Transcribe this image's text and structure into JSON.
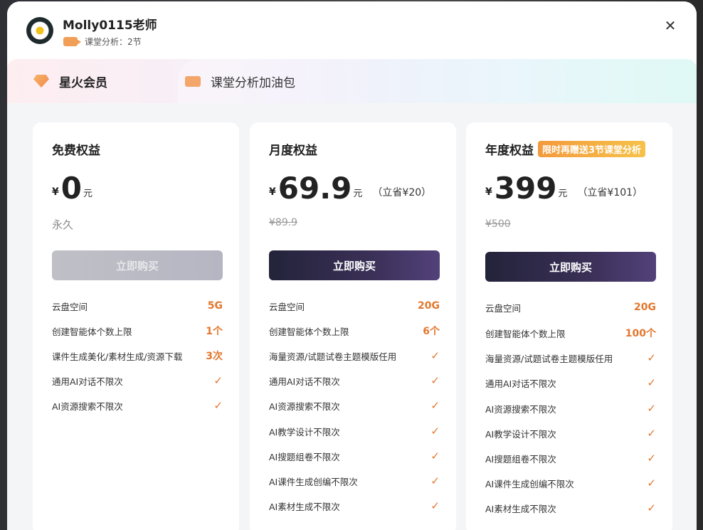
{
  "user": {
    "name": "Molly0115老师",
    "sub_label": "课堂分析：2节"
  },
  "tabs": [
    {
      "label": "星火会员"
    },
    {
      "label": "课堂分析加油包"
    }
  ],
  "plans": [
    {
      "title": "免费权益",
      "currency": "¥",
      "price": "0",
      "unit": "元",
      "note": "永久",
      "button": "立即购买",
      "features": [
        {
          "label": "云盘空间",
          "value": "5G"
        },
        {
          "label": "创建智能体个数上限",
          "value": "1个"
        },
        {
          "label": "课件生成美化/素材生成/资源下载",
          "value": "3次"
        },
        {
          "label": "通用AI对话不限次",
          "value": "✓"
        },
        {
          "label": "AI资源搜索不限次",
          "value": "✓"
        }
      ]
    },
    {
      "title": "月度权益",
      "currency": "¥",
      "price": "69.9",
      "unit": "元",
      "save": "（立省¥20）",
      "original": "¥89.9",
      "button": "立即购买",
      "features": [
        {
          "label": "云盘空间",
          "value": "20G"
        },
        {
          "label": "创建智能体个数上限",
          "value": "6个"
        },
        {
          "label": "海量资源/试题试卷主题模版任用",
          "value": "✓"
        },
        {
          "label": "通用AI对话不限次",
          "value": "✓"
        },
        {
          "label": "AI资源搜索不限次",
          "value": "✓"
        },
        {
          "label": "AI教学设计不限次",
          "value": "✓"
        },
        {
          "label": "AI搜题组卷不限次",
          "value": "✓"
        },
        {
          "label": "AI课件生成创编不限次",
          "value": "✓"
        },
        {
          "label": "AI素材生成不限次",
          "value": "✓"
        }
      ]
    },
    {
      "title": "年度权益",
      "promo": "限时再赠送3节课堂分析",
      "currency": "¥",
      "price": "399",
      "unit": "元",
      "save": "（立省¥101）",
      "original": "¥500",
      "button": "立即购买",
      "features": [
        {
          "label": "云盘空间",
          "value": "20G"
        },
        {
          "label": "创建智能体个数上限",
          "value": "100个"
        },
        {
          "label": "海量资源/试题试卷主题模版任用",
          "value": "✓"
        },
        {
          "label": "通用AI对话不限次",
          "value": "✓"
        },
        {
          "label": "AI资源搜索不限次",
          "value": "✓"
        },
        {
          "label": "AI教学设计不限次",
          "value": "✓"
        },
        {
          "label": "AI搜题组卷不限次",
          "value": "✓"
        },
        {
          "label": "AI课件生成创编不限次",
          "value": "✓"
        },
        {
          "label": "AI素材生成不限次",
          "value": "✓"
        }
      ]
    }
  ],
  "icons": {
    "close": "close-icon",
    "gem": "gem-icon",
    "camera": "video-camera-icon"
  },
  "colors": {
    "accent": "#e2772e",
    "button_dark": "#2b2a44",
    "promo": "#f39a3c"
  }
}
